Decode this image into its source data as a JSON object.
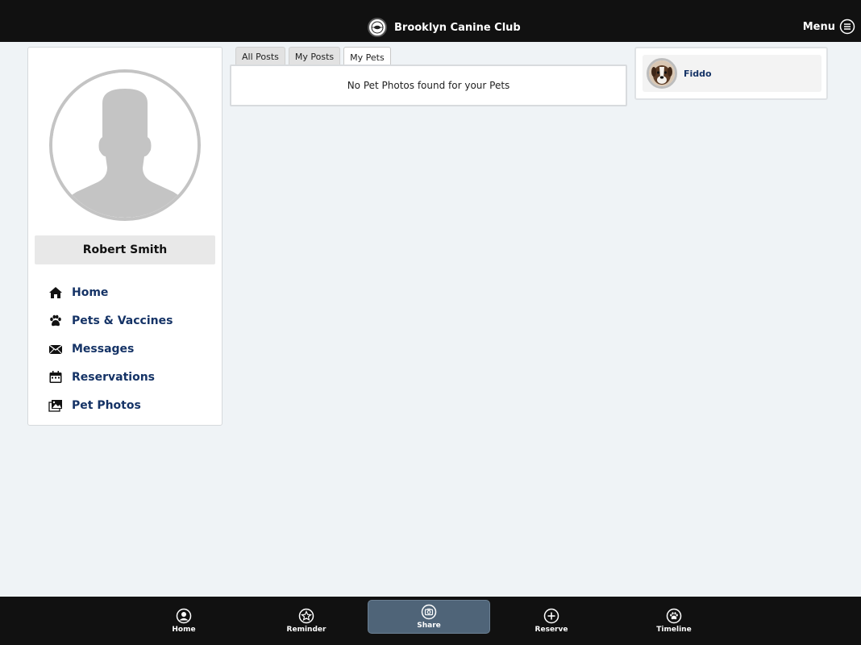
{
  "header": {
    "title": "Brooklyn Canine Club",
    "logo_icon": "club-logo-icon",
    "menu_label": "Menu",
    "menu_icon": "hamburger-circle-icon"
  },
  "profile": {
    "name": "Robert Smith",
    "avatar_icon": "user-silhouette-icon"
  },
  "sidebar": {
    "items": [
      {
        "label": "Home",
        "icon": "home-icon"
      },
      {
        "label": "Pets & Vaccines",
        "icon": "paw-icon"
      },
      {
        "label": "Messages",
        "icon": "envelope-icon"
      },
      {
        "label": "Reservations",
        "icon": "calendar-icon"
      },
      {
        "label": "Pet Photos",
        "icon": "photos-icon"
      }
    ]
  },
  "tabs": [
    {
      "label": "All Posts",
      "active": false
    },
    {
      "label": "My Posts",
      "active": false
    },
    {
      "label": "My Pets",
      "active": true
    }
  ],
  "feed": {
    "empty_message": "No Pet Photos found for your Pets"
  },
  "pets": [
    {
      "name": "Fiddo",
      "icon": "dog-avatar-icon"
    }
  ],
  "bottom_nav": [
    {
      "label": "Home",
      "icon": "user-circle-icon",
      "active": false
    },
    {
      "label": "Reminder",
      "icon": "star-circle-icon",
      "active": false
    },
    {
      "label": "Share",
      "icon": "camera-circle-icon",
      "active": true
    },
    {
      "label": "Reserve",
      "icon": "plus-circle-icon",
      "active": false
    },
    {
      "label": "Timeline",
      "icon": "paw-circle-icon",
      "active": false
    }
  ],
  "colors": {
    "header_bg": "#111111",
    "page_bg": "#eff3f6",
    "link": "#153366",
    "active_nav": "#4f6478"
  }
}
